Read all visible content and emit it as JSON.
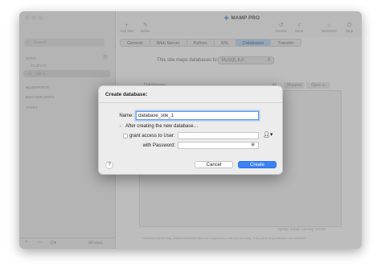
{
  "app": {
    "title": "MAMP PRO"
  },
  "toolbar": {
    "left": [
      {
        "label": "Add Site",
        "icon": "plus-icon"
      },
      {
        "label": "Editor",
        "icon": "editor-icon"
      }
    ],
    "right": [
      {
        "label": "Revert",
        "icon": "revert-icon"
      },
      {
        "label": "Save",
        "icon": "save-icon"
      },
      {
        "label": "WebStart",
        "icon": "webstart-icon"
      },
      {
        "label": "Stop",
        "icon": "power-icon"
      }
    ]
  },
  "sidebar": {
    "search_placeholder": "Search",
    "sections": {
      "sites": "SITES",
      "blueprints": "BLUEPRINTS",
      "inactive": "INACTIVE SITES",
      "tasks": "TASKS"
    },
    "items": [
      "localhost",
      "site-1"
    ],
    "footer": {
      "add": "+",
      "remove": "—",
      "filter": "All sites"
    }
  },
  "tabs": [
    "General",
    "Web Server",
    "Python",
    "SSL",
    "Databases",
    "Transfer"
  ],
  "active_tab": "Databases",
  "databases": {
    "maps_label": "This site maps databases to:",
    "server": "MySQL 8.0",
    "list_label": "Databases:",
    "filters": [
      "All",
      "Mapped",
      "Open in"
    ],
    "status": "MySQL server running: 8.0.35",
    "footer_note": "Disabled entries flag databases/tables that are mapped to a site not an entry. They can't be processed nor selected."
  },
  "dialog": {
    "title": "Create database:",
    "name_label": "Name:",
    "name_value": "database_site_1",
    "after_label": "After creating the new database…",
    "grant_label": "grant access to User:",
    "password_label": "with Password:",
    "cancel": "Cancel",
    "create": "Create",
    "help": "?"
  }
}
